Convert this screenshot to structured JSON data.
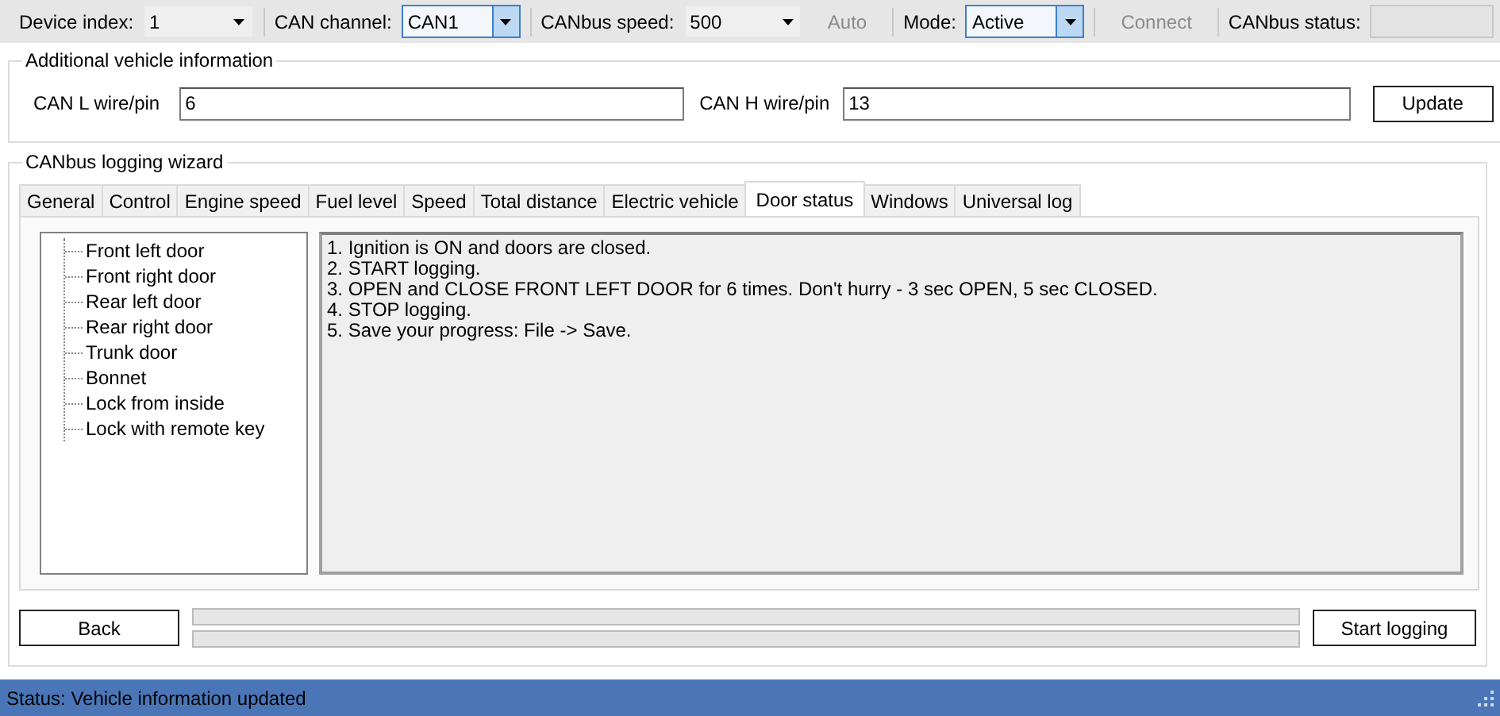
{
  "toolbar": {
    "items": [
      {
        "kind": "label",
        "text": "Device index:"
      },
      {
        "kind": "combo",
        "value": "1",
        "focused": false
      },
      {
        "kind": "sep"
      },
      {
        "kind": "label",
        "text": "CAN channel:"
      },
      {
        "kind": "combo",
        "value": "CAN1",
        "focused": true
      },
      {
        "kind": "sep"
      },
      {
        "kind": "label",
        "text": "CANbus speed:"
      },
      {
        "kind": "combo",
        "value": "500",
        "focused": false
      },
      {
        "kind": "button",
        "text": "Auto",
        "disabled": true
      },
      {
        "kind": "sep"
      },
      {
        "kind": "label",
        "text": "Mode:"
      },
      {
        "kind": "combo",
        "value": "Active",
        "focused": true
      },
      {
        "kind": "sep"
      },
      {
        "kind": "button",
        "text": "Connect",
        "disabled": true
      },
      {
        "kind": "sep"
      },
      {
        "kind": "label",
        "text": "CANbus status:"
      },
      {
        "kind": "status",
        "value": ""
      }
    ]
  },
  "vehicle_info": {
    "title": "Additional vehicle information",
    "can_l": {
      "label": "CAN L wire/pin",
      "value": "6"
    },
    "can_h": {
      "label": "CAN H wire/pin",
      "value": "13"
    },
    "update_button": "Update"
  },
  "wizard": {
    "title": "CANbus logging wizard",
    "tabs": [
      {
        "label": "General",
        "selected": false
      },
      {
        "label": "Control",
        "selected": false
      },
      {
        "label": "Engine speed",
        "selected": false
      },
      {
        "label": "Fuel level",
        "selected": false
      },
      {
        "label": "Speed",
        "selected": false
      },
      {
        "label": "Total distance",
        "selected": false
      },
      {
        "label": "Electric vehicle",
        "selected": false
      },
      {
        "label": "Door status",
        "selected": true
      },
      {
        "label": "Windows",
        "selected": false
      },
      {
        "label": "Universal log",
        "selected": false
      }
    ],
    "tree": [
      "Front left door",
      "Front right door",
      "Rear left door",
      "Rear right door",
      "Trunk door",
      "Bonnet",
      "Lock from inside",
      "Lock with remote key"
    ],
    "instructions": [
      "1. Ignition is ON and doors are closed.",
      "2. START logging.",
      "3. OPEN and CLOSE FRONT LEFT DOOR for 6 times. Don't hurry - 3 sec OPEN, 5 sec CLOSED.",
      "4. STOP logging.",
      "5. Save your progress: File -> Save."
    ],
    "back_button": "Back",
    "progress": [
      {
        "level": 0
      },
      {
        "level": 0
      }
    ],
    "start_button": "Start logging"
  },
  "status_bar": {
    "text": "Status: Vehicle information updated"
  }
}
